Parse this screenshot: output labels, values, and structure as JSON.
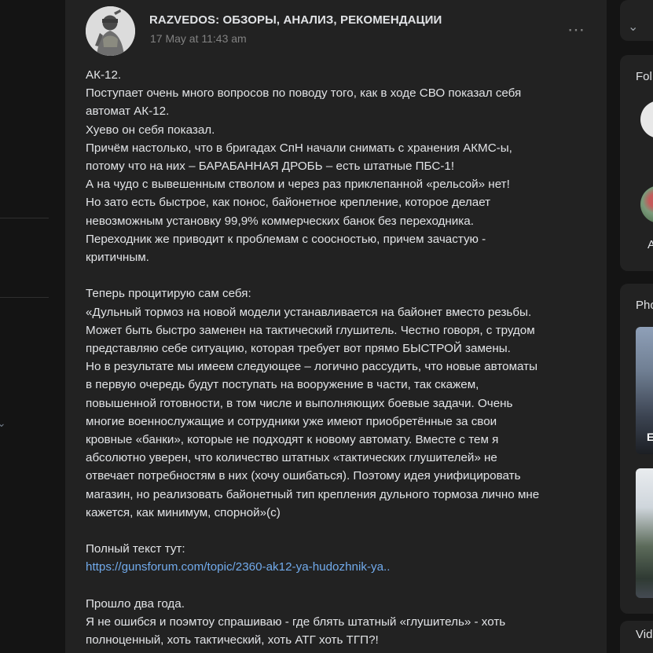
{
  "post": {
    "author": "RAZVEDOS: ОБЗОРЫ, АНАЛИЗ, РЕКОМЕНДАЦИИ",
    "time": "17 May at 11:43 am",
    "more_icon": "⋯",
    "lines": [
      "АК-12.",
      "Поступает очень много вопросов по поводу того, как в ходе СВО показал себя",
      "автомат АК-12.",
      "Хуево он себя показал.",
      "Причём настолько, что в бригадах СпН начали снимать с хранения АКМС-ы,",
      "потому что на них – БАРАБАННАЯ ДРОБЬ – есть штатные ПБС-1!",
      "А на чудо с вывешенным стволом и через раз приклепанной «рельсой» нет!",
      "Но зато есть быстрое, как понос, байонетное крепление, которое делает",
      "невозможным установку 99,9% коммерческих банок без переходника.",
      "Переходник же приводит к проблемам с соосностью, причем зачастую -",
      "критичным.",
      "",
      "Теперь процитирую сам себя:",
      "«Дульный тормоз на новой модели устанавливается на байонет вместо резьбы.",
      "Может быть быстро заменен на тактический глушитель. Честно говоря, с трудом",
      "представляю себе ситуацию, которая требует вот прямо БЫСТРОЙ замены.",
      "Но в результате мы имеем следующее – логично рассудить, что новые автоматы",
      "в первую очередь будут поступать на вооружение в части, так скажем,",
      "повышенной готовности, в том числе и выполняющих боевые задачи. Очень",
      "многие военнослужащие и сотрудники уже имеют приобретённые за свои",
      "кровные «банки», которые не подходят к новому автомату. Вместе с тем я",
      "абсолютно уверен, что количество штатных «тактических глушителей» не",
      "отвечает потребностям в них (хочу ошибаться). Поэтому идея унифицировать",
      "магазин, но реализовать байонетный тип крепления дульного тормоза лично мне",
      "кажется, как минимум, спорной»(с)",
      "",
      "Полный текст тут:"
    ],
    "link": "https://gunsforum.com/topic/2360-ak12-ya-hudozhnik-ya..",
    "lines_after": [
      "",
      "Прошло два года.",
      "Я не ошибся и поэмтоу спрашиваю - где блять штатный «глушитель» - хоть",
      "полноценный, хоть тактический, хоть АТГ хоть ТГП?!"
    ]
  },
  "right": {
    "followers_title": "Fol",
    "follower_initial": "A",
    "photos_title": "Pho",
    "photo_badge": "E",
    "videos_title": "Vid"
  }
}
